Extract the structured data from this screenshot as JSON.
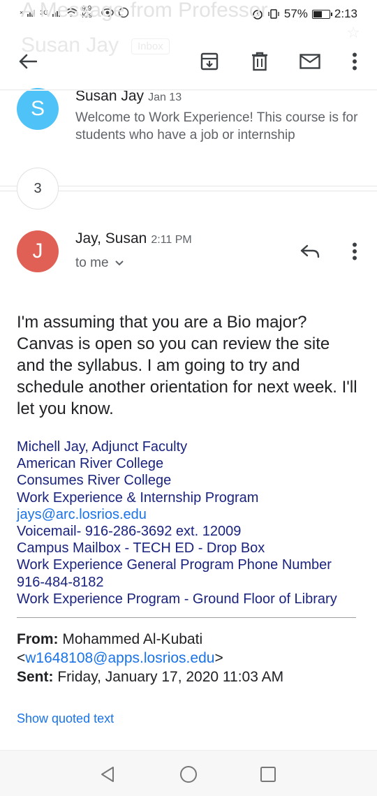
{
  "status_bar": {
    "net_speed": "9.9 K/s",
    "signal1": "×",
    "signal2": "3G",
    "battery": "57%",
    "battery_level": 0.57,
    "time": "2:13"
  },
  "ghost": {
    "subject": "A Message from Professor",
    "sender": "Susan Jay",
    "label": "Inbox"
  },
  "toolbar": {
    "back_icon": "arrow-left-icon",
    "archive_icon": "archive-icon",
    "delete_icon": "trash-icon",
    "unread_icon": "mail-icon",
    "more_icon": "more-vert-icon"
  },
  "collapsed_message": {
    "avatar_letter": "S",
    "avatar_color": "#4fc3f7",
    "sender": "Susan Jay",
    "date": "Jan 13",
    "snippet": "Welcome to Work Experience! This course is for students who have a job or internship"
  },
  "collapsed_count": "3",
  "open_message": {
    "avatar_letter": "J",
    "avatar_color": "#e06055",
    "sender": "Jay, Susan",
    "time": "2:11 PM",
    "recipient": "to me",
    "body": "I'm assuming that you are a Bio major? Canvas is open so you can review the site and the syllabus.  I am going to try and schedule another orientation for next week.  I'll let you know."
  },
  "signature": {
    "name": "Michell Jay, Adjunct Faculty",
    "college1": "American River College",
    "college2": "Consumes River College",
    "program": "Work Experience & Internship Program",
    "email": "jays@arc.losrios.edu",
    "voicemail": "Voicemail- 916-286-3692 ext. 12009",
    "mailbox": "Campus Mailbox - TECH ED - Drop Box",
    "phone_label": "Work Experience General Program Phone Number",
    "phone": "916-484-8182",
    "location": "Work Experience Program - Ground Floor of Library"
  },
  "forwarded": {
    "from_label": "From:",
    "from_name": "Mohammed Al-Kubati",
    "from_email": "w1648108@apps.losrios.edu",
    "sent_label": "Sent:",
    "sent_value": "Friday, January 17, 2020 11:03 AM"
  },
  "show_quoted": "Show quoted text",
  "colors": {
    "accent": "#1a73e8",
    "signature": "#1a237e"
  }
}
